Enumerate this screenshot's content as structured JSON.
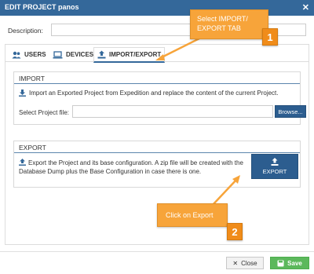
{
  "dialog": {
    "title": "EDIT PROJECT panos",
    "close_icon": "close-icon"
  },
  "description": {
    "label": "Description:",
    "value": ""
  },
  "tabs": [
    {
      "label": "USERS",
      "icon": "users-icon"
    },
    {
      "label": "DEVICES",
      "icon": "laptop-icon"
    },
    {
      "label": "IMPORT/EXPORT",
      "icon": "upload-icon",
      "active": true
    }
  ],
  "import": {
    "legend": "IMPORT",
    "text": "Import an Exported Project from Expedition and replace the content of the current Project.",
    "file_label": "Select Project file:",
    "file_value": "",
    "browse_label": "Browse..."
  },
  "export": {
    "legend": "EXPORT",
    "text": "Export the Project and its base configuration. A zip file will be created with the Database Dump plus the Base Configuration in case there is one.",
    "button_label": "EXPORT"
  },
  "annotations": {
    "callout_1": "Select IMPORT/ EXPORT TAB",
    "badge_1": "1",
    "callout_2": "Click on Export",
    "badge_2": "2"
  },
  "footer": {
    "close_label": "Close",
    "save_label": "Save"
  },
  "colors": {
    "header": "#34689a",
    "primary_button": "#2c5d8f",
    "save": "#5cb85c",
    "callout": "#f7a43a"
  }
}
